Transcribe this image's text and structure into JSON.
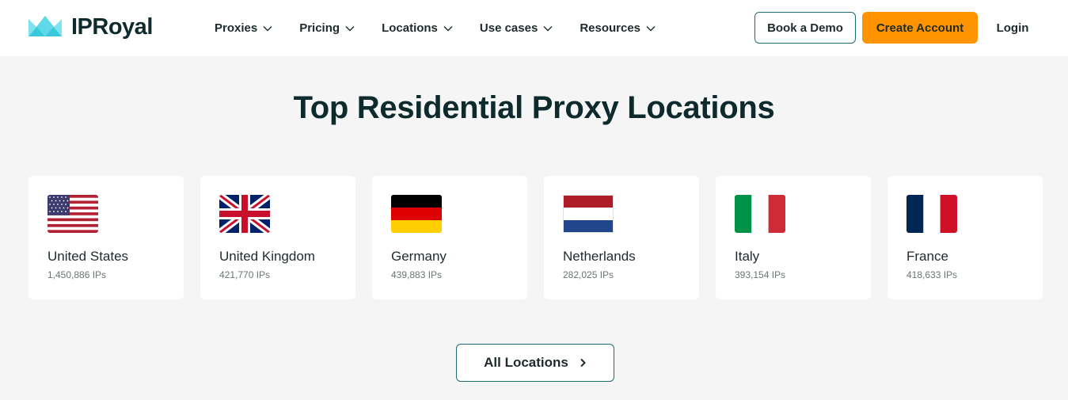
{
  "header": {
    "brand": "IPRoyal",
    "nav": [
      {
        "label": "Proxies"
      },
      {
        "label": "Pricing"
      },
      {
        "label": "Locations"
      },
      {
        "label": "Use cases"
      },
      {
        "label": "Resources"
      }
    ],
    "book_demo": "Book a Demo",
    "create_account": "Create Account",
    "login": "Login"
  },
  "main": {
    "title": "Top Residential Proxy Locations",
    "locations": [
      {
        "name": "United States",
        "ips": "1,450,886 IPs",
        "flag": "us-flag-icon"
      },
      {
        "name": "United Kingdom",
        "ips": "421,770 IPs",
        "flag": "uk-flag-icon"
      },
      {
        "name": "Germany",
        "ips": "439,883 IPs",
        "flag": "germany-flag-icon"
      },
      {
        "name": "Netherlands",
        "ips": "282,025 IPs",
        "flag": "netherlands-flag-icon"
      },
      {
        "name": "Italy",
        "ips": "393,154 IPs",
        "flag": "italy-flag-icon"
      },
      {
        "name": "France",
        "ips": "418,633 IPs",
        "flag": "france-flag-icon"
      }
    ],
    "all_locations": "All Locations"
  },
  "colors": {
    "accent_orange": "#ff9300",
    "outline_teal": "#1e6b73",
    "text_dark": "#0d2a2c",
    "background": "#f5f5f5"
  }
}
